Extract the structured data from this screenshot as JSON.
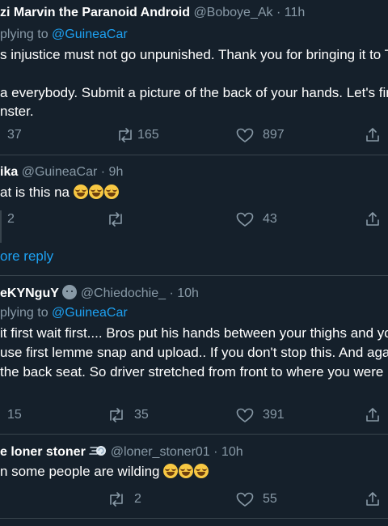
{
  "tweet1": {
    "name": "zi Marvin the Paranoid Android",
    "handle": "@Boboye_Ak",
    "time": "· 11h",
    "replying_prefix": "plying to",
    "replying_to": "@GuineaCar",
    "line1": "s injustice must not go unpunished. Thank you for bringing it to T",
    "line2": "a everybody. Submit a picture of the back of your hands. Let's fir",
    "line3": "nster.",
    "replies": "37",
    "retweets": "165",
    "likes": "897"
  },
  "tweet2": {
    "name": "ika",
    "handle": "@GuineaCar",
    "time": "· 9h",
    "text": "at is this na",
    "emoji_count": 3,
    "replies": "2",
    "retweets": "",
    "likes": "43"
  },
  "show_more": "ore reply",
  "tweet3": {
    "name": "eKYNguY",
    "handle": "@Chiedochie_",
    "time": "· 10h",
    "replying_prefix": "plying to",
    "replying_to": "@GuineaCar",
    "line1": "it first wait first.... Bros put his hands between your thighs and yo",
    "line2": "use first lemme snap and upload.. If you don't stop this. And agai",
    "line3": " the back seat. So driver stretched from front to where you were",
    "replies": "15",
    "retweets": "35",
    "likes": "391"
  },
  "tweet4": {
    "name": "e loner stoner",
    "handle": "@loner_stoner01",
    "time": "· 10h",
    "text": "n some people are wilding",
    "emoji_count": 3,
    "replies": "",
    "retweets": "2",
    "likes": "55"
  },
  "icons": {
    "reply": "reply-icon",
    "retweet": "retweet-icon",
    "like": "heart-icon",
    "share": "share-icon",
    "dash": "dashing-away-icon",
    "emoji": "face-with-tears-of-joy-icon"
  },
  "colors": {
    "background": "#15202b",
    "link": "#1da1f2",
    "muted": "#8899a6",
    "divider": "#38444d"
  }
}
